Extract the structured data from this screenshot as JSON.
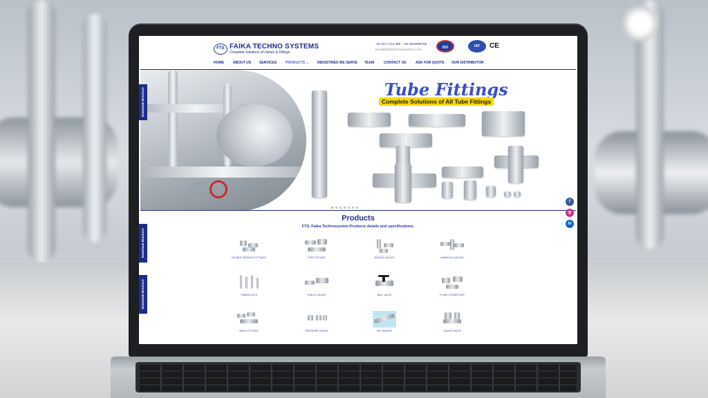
{
  "site": {
    "logo_badge": "FTS",
    "brand_name": "FAIKA TECHNO SYSTEMS",
    "tagline": "Complete Solutions of Valves & Fittings",
    "phone": "+91 917 1711 455 · +91 9615066708",
    "email": "[email]@faikatechnosystems.com",
    "certifications": [
      "ISO",
      "IAF",
      "CE"
    ]
  },
  "nav": {
    "items": [
      "HOME",
      "ABOUT US",
      "SERVICES",
      "PRODUCTS ⌄",
      "INDUSTRIES WE SERVE",
      "TEAM",
      "CONTACT US",
      "ASK FOR QUOTE",
      "OUR DISTRIBUTOR"
    ],
    "active_index": 3
  },
  "hero": {
    "title": "Tube Fittings",
    "subtitle": "Complete Solutions of All Tube Fittings",
    "slide_count": 7,
    "active_slide": 0
  },
  "side_tabs": [
    "Download Brochure",
    "Download Brochure",
    "Download Brochure"
  ],
  "social": [
    {
      "name": "facebook-icon",
      "glyph": "f",
      "color": "#3b5998"
    },
    {
      "name": "instagram-icon",
      "glyph": "◎",
      "color": "#c13584"
    },
    {
      "name": "linkedin-icon",
      "glyph": "in",
      "color": "#0a66c2"
    }
  ],
  "products": {
    "title": "Products",
    "description": "FTS, Faika Technosystem Products details and specifications.",
    "items": [
      "DOUBLE FERRULE FITTINGS",
      "PIPE FITTINGS",
      "NEEDLE VALVES",
      "MANIFOLD VALVES",
      "TUBING NUTS",
      "CHECK VALVES",
      "BALL VALVE",
      "FLARE CONNECTOR",
      "WELD FITTINGS",
      "PRESSURE GAUGE",
      "AIR HEADER",
      "GAUGE VALVE"
    ]
  },
  "colors": {
    "brand_blue": "#1e2c8a",
    "hero_title": "#3b4fc4",
    "highlight_yellow": "#f6d800"
  }
}
